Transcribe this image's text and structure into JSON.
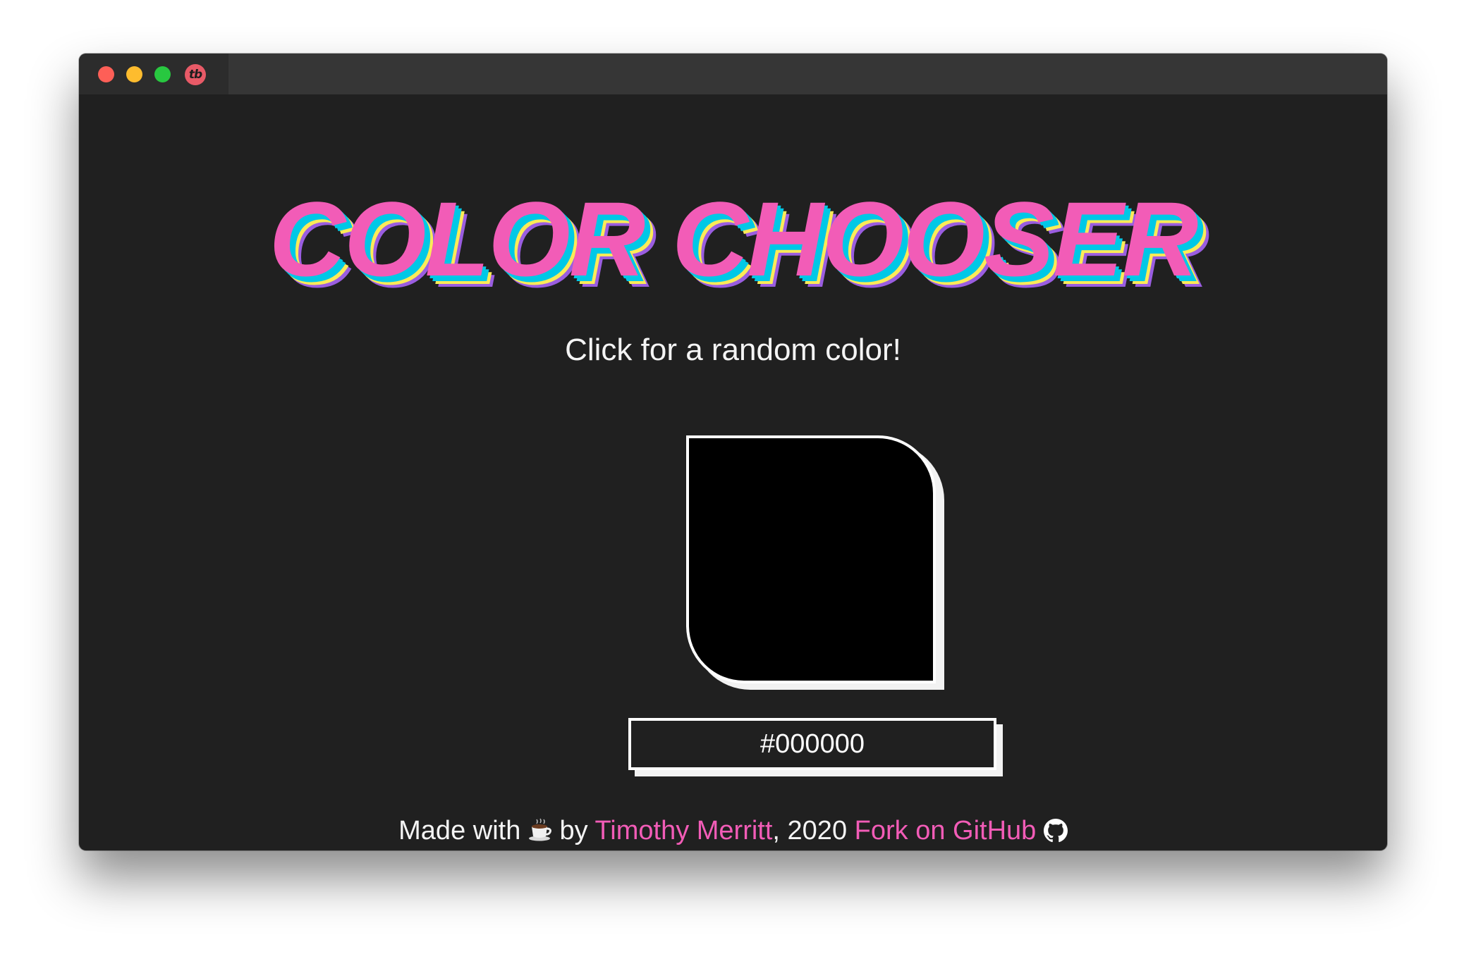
{
  "window": {
    "app_icon_label": "tb"
  },
  "main": {
    "title": "COLOR CHOOSER",
    "subtitle": "Click for a random color!",
    "swatch_color": "#000000",
    "hex_value": "#000000"
  },
  "footer": {
    "made_with": "Made with",
    "by": "by",
    "author_link": "Timothy Merritt",
    "year": ", 2020",
    "fork_link": "Fork on GitHub",
    "coffee_icon": "coffee-cup-icon",
    "github_icon": "github-icon"
  },
  "colors": {
    "background": "#202020",
    "accent_pink": "#f25cb7",
    "shadow_cyan": "#00c8e6",
    "shadow_yellow": "#fbeb57",
    "shadow_purple": "#9a5de0",
    "text": "#f4f4f4"
  }
}
